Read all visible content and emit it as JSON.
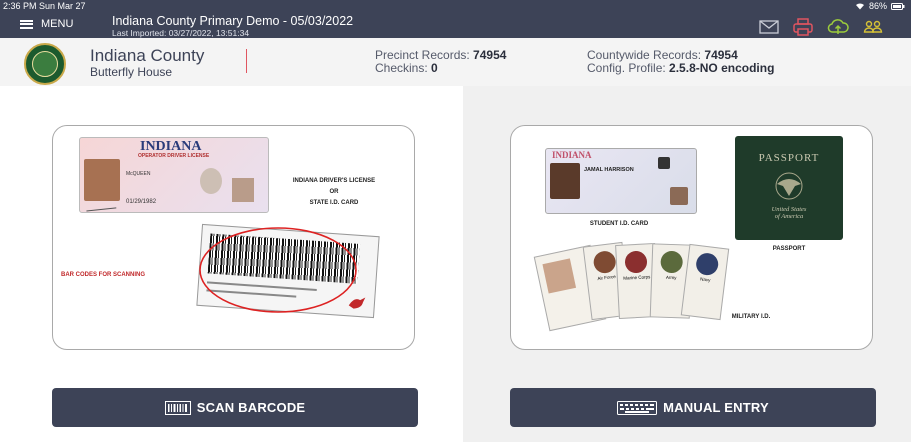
{
  "status_bar": {
    "time_date": "2:36 PM  Sun Mar 27",
    "battery": "86%"
  },
  "header": {
    "menu_label": "MENU",
    "election_title": "Indiana County Primary Demo - 05/03/2022",
    "last_imported": "Last Imported: 03/27/2022, 13:51:34",
    "icons": [
      "mail-icon",
      "printer-icon",
      "cloud-sync-icon",
      "users-icon"
    ]
  },
  "info": {
    "county": "Indiana County",
    "location": "Butterfly House",
    "precinct_records_label": "Precinct Records:",
    "precinct_records_value": "74954",
    "checkins_label": "Checkins:",
    "checkins_value": "0",
    "countywide_records_label": "Countywide Records:",
    "countywide_records_value": "74954",
    "config_profile_label": "Config. Profile:",
    "config_profile_value": "2.5.8-NO encoding"
  },
  "scan_card": {
    "state_title": "INDIANA",
    "license_subtitle": "OPERATOR DRIVER LICENSE",
    "license_name": "McQUEEN",
    "license_dob": "01/29/1982",
    "caption_line1": "INDIANA DRIVER'S LICENSE",
    "caption_or": "OR",
    "caption_line2": "STATE I.D. CARD",
    "barcode_caption": "BAR CODES FOR SCANNING"
  },
  "manual_card": {
    "student_state": "INDIANA",
    "student_name": "JAMAL HARRISON",
    "student_caption": "STUDENT I.D. CARD",
    "passport_title": "PASSPORT",
    "passport_country_1": "United States",
    "passport_country_2": "of America",
    "passport_caption": "PASSPORT",
    "military_caption": "MILITARY I.D.",
    "military_branches": [
      "Air Force",
      "Marine Corps",
      "Army",
      "Navy"
    ]
  },
  "buttons": {
    "scan_label": "SCAN BARCODE",
    "manual_label": "MANUAL ENTRY"
  },
  "colors": {
    "header_bg": "#3d4357",
    "accent_red": "#e05560",
    "accent_green": "#9ccc3c",
    "accent_yellow": "#d6c236"
  }
}
